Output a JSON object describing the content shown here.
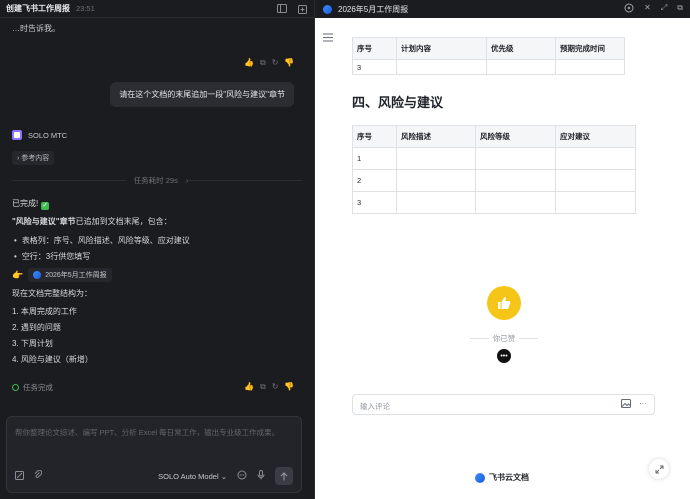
{
  "left": {
    "title": "创建飞书工作周报",
    "time": "23:51",
    "cut_text": "…时告诉我。",
    "user_message": "请在这个文档的末尾追加一段\"风险与建议\"章节",
    "agent_name": "SOLO MTC",
    "ref_label": "参考内容",
    "task_time": "任务耗时 29s",
    "done_label": "已完成!",
    "summary_bold": "\"风险与建议\"章节",
    "summary_rest": "已追加到文档末尾，包含：",
    "bullets": [
      "表格列：序号、风险描述、风险等级、应对建议",
      "空行：3行供您填写"
    ],
    "doc_chip": "2026年5月工作周报",
    "structure_intro": "现在文档完整结构为：",
    "structure": [
      "1. 本周完成的工作",
      "2. 遇到的问题",
      "3. 下周计划",
      "4. 风险与建议（新增）"
    ],
    "status": "任务完成",
    "composer_placeholder": "帮你整理论文综述、编写 PPT、分析 Excel 每日常工作，输出专业级工作成果。",
    "model": "SOLO Auto Model"
  },
  "right": {
    "title": "2026年5月工作周报",
    "table1": {
      "headers": [
        "序号",
        "计划内容",
        "优先级",
        "预期完成时间"
      ],
      "rows": [
        [
          "3",
          "",
          "",
          ""
        ]
      ]
    },
    "section_title": "四、风险与建议",
    "table2": {
      "headers": [
        "序号",
        "风险描述",
        "风险等级",
        "应对建议"
      ],
      "rows": [
        [
          "1",
          "",
          "",
          ""
        ],
        [
          "2",
          "",
          "",
          ""
        ],
        [
          "3",
          "",
          "",
          ""
        ]
      ]
    },
    "liked_text": "你已赞",
    "avatar_text": "•••",
    "comment_placeholder": "输入评论",
    "brand": "飞书云文档"
  },
  "colors": {
    "accent_like": "#f5c518",
    "success": "#3fb950"
  }
}
